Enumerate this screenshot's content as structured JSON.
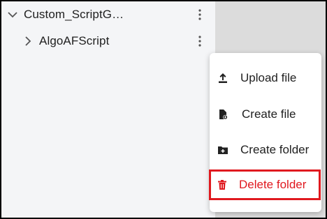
{
  "tree": {
    "root": {
      "label": "Custom_ScriptG…",
      "expanded": true
    },
    "child": {
      "label": "AlgoAFScript",
      "expanded": false
    }
  },
  "context_menu": {
    "items": [
      {
        "label": "Upload file",
        "icon": "upload-icon"
      },
      {
        "label": "Create file",
        "icon": "file-add-icon"
      },
      {
        "label": "Create folder",
        "icon": "folder-add-icon"
      },
      {
        "label": "Delete folder",
        "icon": "trash-icon",
        "highlighted": true,
        "color": "#e0191f"
      }
    ]
  },
  "colors": {
    "text": "#1f1f1f",
    "danger": "#e0191f",
    "pane_bg": "#f4f5f7",
    "right_bg": "#dcdcdc"
  }
}
